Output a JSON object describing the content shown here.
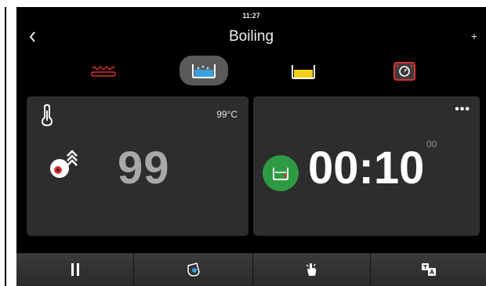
{
  "status_bar": {
    "time": "11:27"
  },
  "header": {
    "title": "Boiling",
    "back_icon": "chevron-left-icon",
    "add_label": "+"
  },
  "modes": [
    {
      "name": "grill",
      "icon": "grill-icon",
      "selected": false
    },
    {
      "name": "boil",
      "icon": "boil-pot-icon",
      "selected": true
    },
    {
      "name": "oil",
      "icon": "oil-pot-icon",
      "selected": false
    },
    {
      "name": "timer",
      "icon": "timer-pan-icon",
      "selected": false
    }
  ],
  "temperature_panel": {
    "thermometer_icon": "thermometer-icon",
    "target": "99°C",
    "probe_icon": "probe-icon",
    "value": "99"
  },
  "timer_panel": {
    "more_label": "•••",
    "pot_icon": "pot-icon",
    "value": "00:10",
    "seconds": "00"
  },
  "bottom_bar": [
    {
      "name": "pause",
      "icon": "pause-icon"
    },
    {
      "name": "timer",
      "icon": "timer-icon"
    },
    {
      "name": "hand",
      "icon": "hand-icon"
    },
    {
      "name": "translate",
      "icon": "translate-icon"
    }
  ],
  "colors": {
    "background": "#000000",
    "panel": "#2d2d2d",
    "selected_mode": "#5a5a5a",
    "timer_badge": "#2f9a44",
    "temp_value": "#a8a8a8",
    "boil_water": "#3aa0e0",
    "oil": "#f2d11a",
    "grill_red": "#e03030"
  }
}
